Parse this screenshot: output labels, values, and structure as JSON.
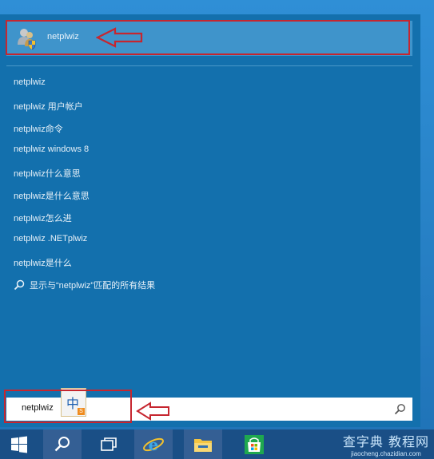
{
  "best_match": {
    "label": "netplwiz",
    "icon": "users-shield-icon"
  },
  "suggestions": [
    "netplwiz",
    "netplwiz 用户帐户",
    "netplwiz命令",
    "netplwiz windows 8",
    "netplwiz什么意思",
    "netplwiz是什么意思",
    "netplwiz怎么进",
    "netplwiz .NETplwiz",
    "netplwiz是什么"
  ],
  "search_all": {
    "label": "显示与“netplwiz”匹配的所有结果",
    "icon": "search-icon"
  },
  "search_box": {
    "value": "netplwiz",
    "icon": "search-icon"
  },
  "ime": {
    "char": "中",
    "sub": "S"
  },
  "taskbar": {
    "items": [
      "start-button",
      "search-button",
      "task-view-button",
      "internet-explorer",
      "file-explorer",
      "store"
    ]
  },
  "watermark": {
    "title": "查字典 教程网",
    "url": "jiaocheng.chazidian.com"
  },
  "colors": {
    "panel": "#1370ad",
    "highlight": "#3f94cb",
    "taskbar": "#1a4f86",
    "callout": "#c6262f"
  }
}
